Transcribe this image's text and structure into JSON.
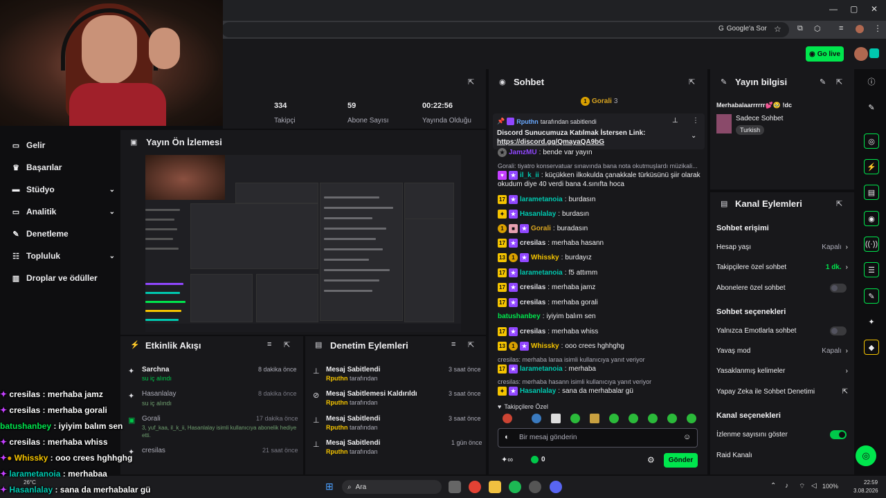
{
  "browser": {
    "google_search_label": "Google'a Sor",
    "minimize": "—",
    "maximize": "▢",
    "close": "✕"
  },
  "topnav": {
    "go_live_label": "Go live"
  },
  "sidebar": {
    "items": [
      {
        "label": "Gelir",
        "icon": "dollar-icon"
      },
      {
        "label": "Başarılar",
        "icon": "trophy-icon"
      },
      {
        "label": "Stüdyo",
        "icon": "studio-icon",
        "expandable": true
      },
      {
        "label": "Analitik",
        "icon": "analytics-icon",
        "expandable": true
      },
      {
        "label": "Denetleme",
        "icon": "wrench-icon"
      },
      {
        "label": "Topluluk",
        "icon": "community-icon",
        "expandable": true
      },
      {
        "label": "Droplar ve ödüller",
        "icon": "gift-icon"
      }
    ]
  },
  "stats": [
    {
      "value": "334",
      "label": "Takipçi"
    },
    {
      "value": "59",
      "label": "Abone Sayısı"
    },
    {
      "value": "00:22:56",
      "label": "Yayında Olduğu"
    }
  ],
  "preview": {
    "title": "Yayın Ön İzlemesi"
  },
  "activity_feed": {
    "title": "Etkinlik Akışı",
    "items": [
      {
        "name": "Sarchna",
        "detail": "su iç alındı",
        "time": "8 dakika önce"
      },
      {
        "name": "Hasanlalay",
        "detail": "su iç alındı",
        "time": "8 dakika önce"
      },
      {
        "name": "Gorali",
        "detail": "3, yuf_kaa, il_k_ii, Hasanlalay isimli kullanıcıya abonelik hediye etti.",
        "time": "17 dakika önce"
      },
      {
        "name": "cresilas",
        "detail": "",
        "time": "21 saat önce"
      }
    ]
  },
  "mod_actions": {
    "title": "Denetim Eylemleri",
    "items": [
      {
        "action": "Mesaj Sabitlendi",
        "by": "Rputhn",
        "by_suffix": "tarafından",
        "time": "3 saat önce"
      },
      {
        "action": "Mesaj Sabitlemesi Kaldırıldı",
        "by": "Rputhn",
        "by_suffix": "tarafından",
        "time": "3 saat önce"
      },
      {
        "action": "Mesaj Sabitlendi",
        "by": "Rputhn",
        "by_suffix": "tarafından",
        "time": "3 saat önce"
      },
      {
        "action": "Mesaj Sabitlendi",
        "by": "Rputhn",
        "by_suffix": "tarafından",
        "time": "1 gün önce"
      }
    ]
  },
  "chat": {
    "title": "Sohbet",
    "hype_user": "Gorali",
    "hype_count": "3",
    "pinned_by": "Rputhn",
    "pinned_suffix": "tarafından sabitlendi",
    "pinned_text": "Discord Sunucumuza Katılmak İstersen Link:",
    "pinned_link": "https://discord.gg/QmayaQA9bG",
    "messages": [
      {
        "user": "JamzMU",
        "text": "bende var yayın",
        "color": "#9147ff"
      },
      {
        "reply": "Gorali: tiyatro konservatuar sınavında bana nota okutmuşlardı müzikali..."
      },
      {
        "user": "il_k_ii",
        "text": "küçükken ilkokulda çanakkale türküsünü şiir olarak",
        "text2": "okudum diye 40 verdi bana 4.sınıfta hoca",
        "color": "#00c8af"
      },
      {
        "user": "larametanoia",
        "text": "burdasın",
        "color": "#00c8af",
        "badge": "17"
      },
      {
        "user": "Hasanlalay",
        "text": "burdasın",
        "color": "#00c8af"
      },
      {
        "user": "Gorali",
        "text": "buradasın",
        "color": "#daa520"
      },
      {
        "user": "cresilas",
        "text": "merhaba hasann",
        "color": "#dedee3",
        "badge": "17"
      },
      {
        "user": "Whissky",
        "text": "burdayız",
        "color": "#f5c400",
        "badge": "13"
      },
      {
        "user": "larametanoia",
        "text": "f5 attımm",
        "color": "#00c8af",
        "badge": "17"
      },
      {
        "user": "cresilas",
        "text": "merhaba jamz",
        "color": "#dedee3",
        "badge": "17"
      },
      {
        "user": "cresilas",
        "text": "merhaba gorali",
        "color": "#dedee3",
        "badge": "17"
      },
      {
        "user": "batushanbey",
        "text": "iyiyim balım sen",
        "color": "#00e64d"
      },
      {
        "user": "cresilas",
        "text": "merhaba whiss",
        "color": "#dedee3",
        "badge": "17"
      },
      {
        "user": "Whissky",
        "text": "ooo crees hghhghg",
        "color": "#f5c400",
        "badge": "13"
      },
      {
        "reply": "cresilas: merhaba laraa isimli kullanıcıya yanıt veriyor"
      },
      {
        "user": "larametanoia",
        "text": "merhaba",
        "color": "#00c8af",
        "badge": "17"
      },
      {
        "reply": "cresilas: merhaba hasann isimli kullanıcıya yanıt veriyor"
      },
      {
        "user": "Hasanlalay",
        "text": "sana da merhabalar gü",
        "color": "#00c8af"
      }
    ],
    "followers_only": "Takipçilere Özel",
    "input_placeholder": "Bir mesaj gönderin",
    "points": "0",
    "send_label": "Gönder"
  },
  "stream_info": {
    "title": "Yayın bilgisi",
    "stream_title": "Merhabalaarrrrrr💕🥹 !dc",
    "category": "Sadece Sohbet",
    "tag": "Turkish"
  },
  "channel_actions": {
    "title": "Kanal Eylemleri",
    "chat_access_heading": "Sohbet erişimi",
    "account_age_label": "Hesap yaşı",
    "account_age_value": "Kapalı",
    "followers_chat_label": "Takipçilere özel sohbet",
    "followers_chat_value": "1 dk.",
    "subs_chat_label": "Abonelere özel sohbet",
    "chat_options_heading": "Sohbet seçenekleri",
    "emote_only_label": "Yalnızca Emotlarla sohbet",
    "slow_mode_label": "Yavaş mod",
    "slow_mode_value": "Kapalı",
    "banned_words_label": "Yasaklanmış kelimeler",
    "ai_mod_label": "Yapay Zeka ile Sohbet Denetimi",
    "channel_options_heading": "Kanal seçenekleri",
    "show_viewers_label": "İzlenme sayısını göster",
    "raid_label": "Raid Kanalı"
  },
  "overlay_chat": [
    {
      "user": "cresilas",
      "text": " : merhaba jamz",
      "color": "#ffffff"
    },
    {
      "user": "cresilas",
      "text": " : merhaba gorali",
      "color": "#ffffff"
    },
    {
      "user": "batushanbey",
      "text": " : iyiyim balım sen",
      "color": "#00e64d"
    },
    {
      "user": "cresilas",
      "text": " : merhaba whiss",
      "color": "#ffffff"
    },
    {
      "user": "Whissky",
      "text": " : ooo crees hghhghg",
      "color": "#f5c400"
    },
    {
      "user": "larametanoia",
      "text": " : merhabaa",
      "color": "#00c8af"
    },
    {
      "user": "Hasanlalay",
      "text": " : sana da merhabalar gü",
      "color": "#00c8af"
    }
  ],
  "taskbar": {
    "weather": "26°C",
    "search_label": "Ara",
    "battery": "100%",
    "time": "22:59",
    "date": "3.08.2026"
  },
  "colors": {
    "accent": "#00e64d",
    "teal": "#00c8af",
    "background": "#0e0e10",
    "panel": "#18181b"
  }
}
